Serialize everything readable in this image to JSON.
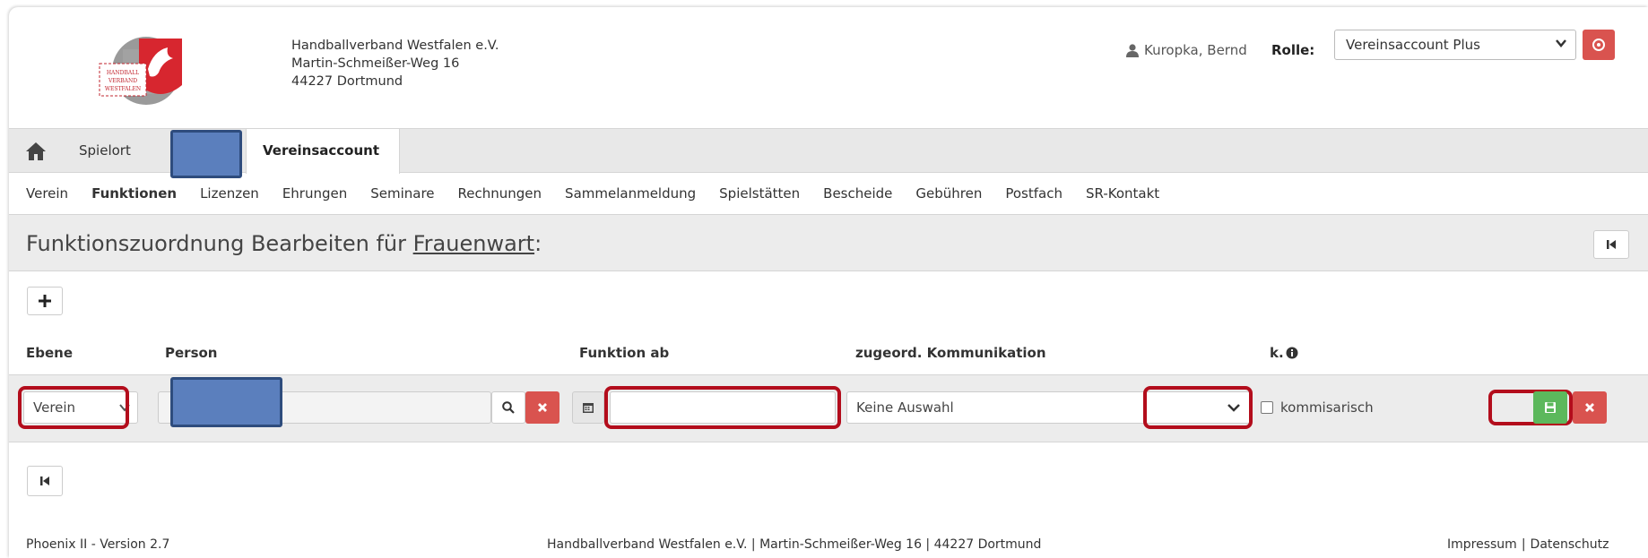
{
  "org": {
    "name": "Handballverband Westfalen e.V.",
    "street": "Martin-Schmeißer-Weg 16",
    "city": "44227 Dortmund",
    "logo_text": "HANDBALL VERBAND WESTFALEN"
  },
  "header": {
    "user_name": "Kuropka, Bernd",
    "role_label": "Rolle:",
    "role_value": "Vereinsaccount Plus"
  },
  "tabs": {
    "spielort": "Spielort",
    "active": "Vereinsaccount"
  },
  "nav": [
    "Verein",
    "Funktionen",
    "Lizenzen",
    "Ehrungen",
    "Seminare",
    "Rechnungen",
    "Sammelanmeldung",
    "Spielstätten",
    "Bescheide",
    "Gebühren",
    "Postfach",
    "SR-Kontakt"
  ],
  "nav_active_index": 1,
  "page": {
    "title_prefix": "Funktionszuordnung Bearbeiten für",
    "title_link": "Frauenwart",
    "title_suffix": ":"
  },
  "columns": {
    "ebene": "Ebene",
    "person": "Person",
    "funktion_ab": "Funktion ab",
    "kommunikation": "zugeord. Kommunikation",
    "k": "k."
  },
  "row": {
    "ebene_value": "Verein",
    "person_value": "",
    "funktion_ab_value": "",
    "kommunikation_value": "Keine Auswahl",
    "kommissarisch_label": "kommisarisch"
  },
  "footer": {
    "version": "Phoenix II - Version 2.7",
    "address": "Handballverband Westfalen e.V. | Martin-Schmeißer-Weg 16 | 44227 Dortmund",
    "impressum": "Impressum",
    "separator": "|",
    "datenschutz": "Datenschutz"
  },
  "colors": {
    "danger": "#d9534f",
    "success": "#5cb85c",
    "highlight": "#b30d1c",
    "redaction": "#5b7fbd"
  }
}
